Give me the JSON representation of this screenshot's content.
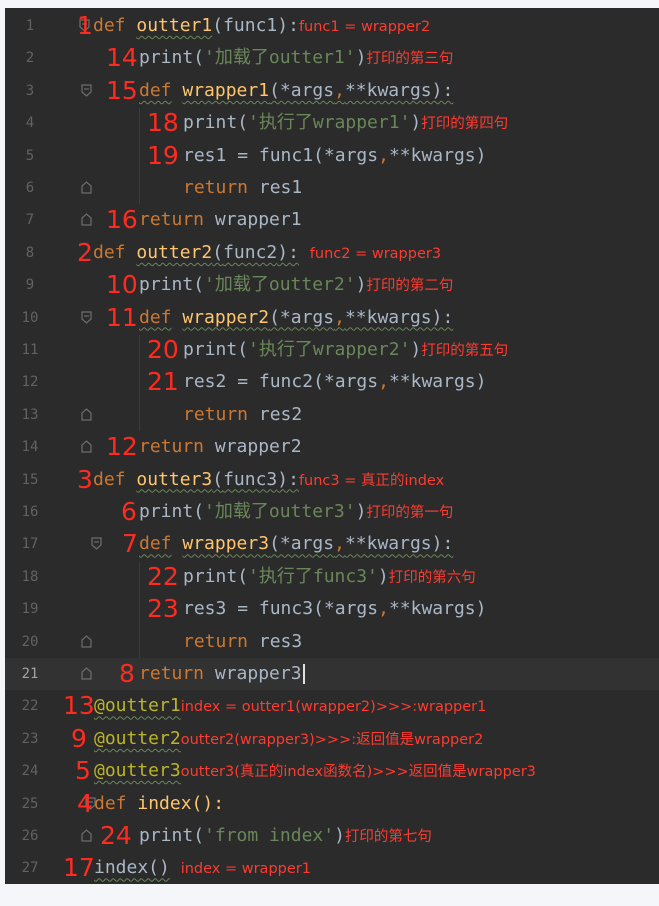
{
  "editor": {
    "current_line": 21,
    "lines": [
      {
        "n": "1",
        "num": "1",
        "ann": "func1 = wrapper2"
      },
      {
        "n": "2",
        "num": "14",
        "ann": "打印的第三句",
        "str": "'加载了outter1'"
      },
      {
        "n": "3",
        "num": "15"
      },
      {
        "n": "4",
        "num": "18",
        "ann": "打印的第四句",
        "str": "'执行了wrapper1'"
      },
      {
        "n": "5",
        "num": "19"
      },
      {
        "n": "6",
        "num": ""
      },
      {
        "n": "7",
        "num": "16"
      },
      {
        "n": "8",
        "num": "2",
        "ann": "func2 = wrapper3"
      },
      {
        "n": "9",
        "num": "10",
        "ann": "打印的第二句",
        "str": "'加载了outter2'"
      },
      {
        "n": "10",
        "num": "11"
      },
      {
        "n": "11",
        "num": "20",
        "ann": "打印的第五句",
        "str": "'执行了wrapper2'"
      },
      {
        "n": "12",
        "num": "21"
      },
      {
        "n": "13",
        "num": ""
      },
      {
        "n": "14",
        "num": "12"
      },
      {
        "n": "15",
        "num": "3",
        "ann": "func3 = 真正的index"
      },
      {
        "n": "16",
        "num": "6",
        "ann": "打印的第一句",
        "str": "'加载了outter3'"
      },
      {
        "n": "17",
        "num": "7"
      },
      {
        "n": "18",
        "num": "22",
        "ann": "打印的第六句",
        "str": "'执行了func3'"
      },
      {
        "n": "19",
        "num": "23"
      },
      {
        "n": "20",
        "num": ""
      },
      {
        "n": "21",
        "num": "8"
      },
      {
        "n": "22",
        "num": "13",
        "ann": "index = outter1(wrapper2)>>>:wrapper1"
      },
      {
        "n": "23",
        "num": "9",
        "ann": "outter2(wrapper3)>>>:返回值是wrapper2"
      },
      {
        "n": "24",
        "num": "5",
        "ann": "outter3(真正的index函数名)>>>返回值是wrapper3"
      },
      {
        "n": "25",
        "num": "4"
      },
      {
        "n": "26",
        "num": "24",
        "ann": "打印的第七句",
        "str": "'from index'"
      },
      {
        "n": "27",
        "num": "17",
        "ann": "index = wrapper1"
      }
    ],
    "tokens": {
      "def": "def",
      "return": "return",
      "print": "print",
      "outter1": "outter1",
      "outter2": "outter2",
      "outter3": "outter3",
      "func1": "func1",
      "func2": "func2",
      "func3": "func3",
      "wrapper1": "wrapper1",
      "wrapper2": "wrapper2",
      "wrapper3": "wrapper3",
      "res1": "res1",
      "res2": "res2",
      "res3": "res3",
      "args": "(*args",
      "kwargs": "**kwargs):",
      "kwargs_call": "**kwargs)",
      "dec1": "@outter1",
      "dec2": "@outter2",
      "dec3": "@outter3",
      "index": "index",
      "index_def": "index():",
      "index_call": "index()"
    }
  },
  "colors": {
    "editor_bg": "#2b2b2b",
    "keyword": "#cc7832",
    "function": "#ffc66d",
    "string": "#6a8759",
    "decorator": "#bbb529",
    "annotation": "#ff2a20"
  }
}
